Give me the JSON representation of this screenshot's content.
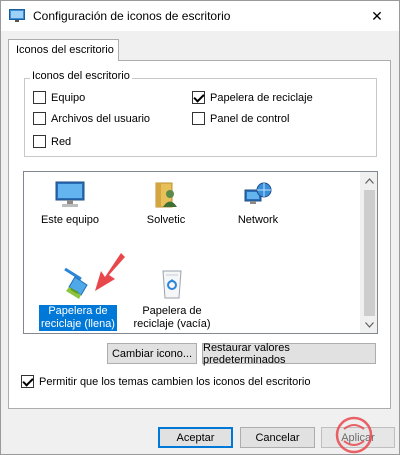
{
  "window": {
    "title": "Configuración de iconos de escritorio",
    "close_glyph": "✕"
  },
  "tab": {
    "label": "Iconos del escritorio"
  },
  "group": {
    "legend": "Iconos del escritorio",
    "checkboxes": [
      {
        "label": "Equipo",
        "checked": false
      },
      {
        "label": "Papelera de reciclaje",
        "checked": true
      },
      {
        "label": "Archivos del usuario",
        "checked": false
      },
      {
        "label": "Panel de control",
        "checked": false
      },
      {
        "label": "Red",
        "checked": false
      }
    ]
  },
  "icons": [
    {
      "label": "Este equipo",
      "icon": "computer-icon",
      "selected": false
    },
    {
      "label": "Solvetic",
      "icon": "user-folder-icon",
      "selected": false
    },
    {
      "label": "Network",
      "icon": "network-icon",
      "selected": false
    },
    {
      "label_line1": "Papelera de",
      "label_line2": "reciclaje (llena)",
      "icon": "recycle-bin-full-icon",
      "selected": true
    },
    {
      "label_line1": "Papelera de",
      "label_line2": "reciclaje (vacía)",
      "icon": "recycle-bin-empty-icon",
      "selected": false
    }
  ],
  "buttons": {
    "change_icon": "Cambiar icono...",
    "restore_defaults": "Restaurar valores predeterminados",
    "ok": "Aceptar",
    "cancel": "Cancelar",
    "apply": "Aplicar"
  },
  "themes_checkbox": {
    "label": "Permitir que los temas cambien los iconos del escritorio",
    "checked": true
  },
  "colors": {
    "selection": "#0078d7",
    "annotation_arrow": "#e8474c"
  }
}
